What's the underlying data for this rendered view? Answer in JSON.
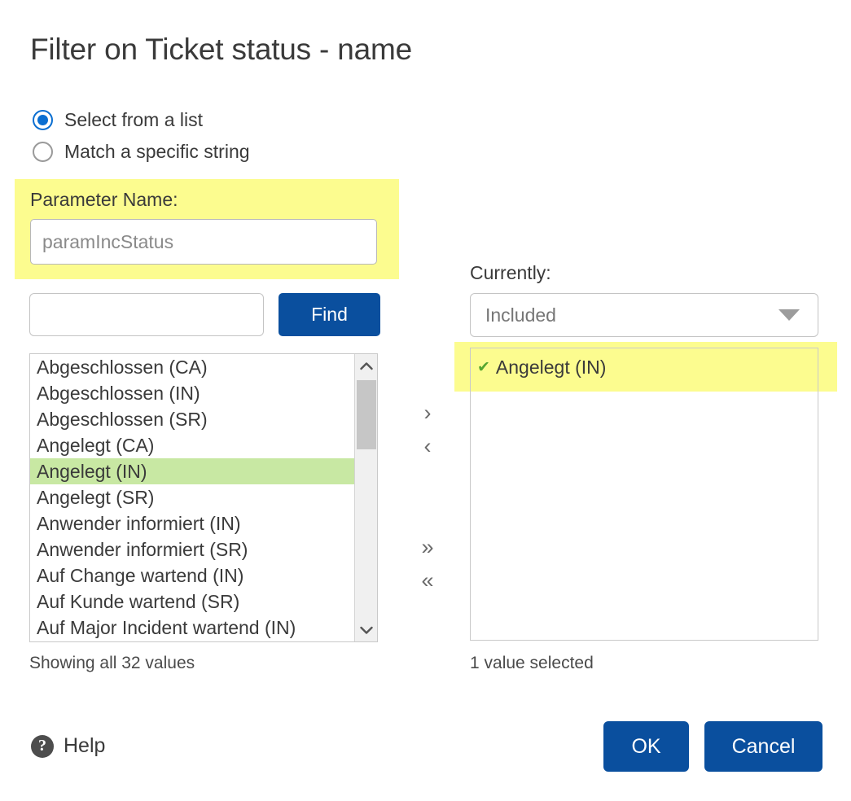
{
  "dialog": {
    "title": "Filter on Ticket status - name"
  },
  "mode": {
    "options": [
      {
        "label": "Select from a list",
        "selected": true
      },
      {
        "label": "Match a specific string",
        "selected": false
      }
    ]
  },
  "parameter": {
    "label": "Parameter Name:",
    "value": "paramIncStatus",
    "placeholder": "paramIncStatus",
    "highlight_color": "#fcfc8f"
  },
  "search": {
    "value": "",
    "placeholder": "",
    "find_label": "Find"
  },
  "available_list": {
    "items": [
      {
        "label": "Abgeschlossen (CA)",
        "selected": false
      },
      {
        "label": "Abgeschlossen (IN)",
        "selected": false
      },
      {
        "label": "Abgeschlossen (SR)",
        "selected": false
      },
      {
        "label": "Angelegt (CA)",
        "selected": false
      },
      {
        "label": "Angelegt (IN)",
        "selected": true
      },
      {
        "label": "Angelegt (SR)",
        "selected": false
      },
      {
        "label": "Anwender informiert (IN)",
        "selected": false
      },
      {
        "label": "Anwender informiert (SR)",
        "selected": false
      },
      {
        "label": "Auf Change wartend (IN)",
        "selected": false
      },
      {
        "label": "Auf Kunde wartend (SR)",
        "selected": false
      },
      {
        "label": "Auf Major Incident wartend (IN)",
        "selected": false
      }
    ],
    "selection_color": "#c8e8a3",
    "status": "Showing all 32 values"
  },
  "transfer": {
    "add": "›",
    "remove": "‹",
    "add_all": "»",
    "remove_all": "«"
  },
  "currently": {
    "label": "Currently:",
    "mode_value": "Included",
    "selected_items": [
      {
        "label": "Angelegt (IN)",
        "check": "✔"
      }
    ],
    "highlight_color": "#fcfc8f",
    "check_color": "#55a630",
    "status": "1 value selected"
  },
  "footer": {
    "help_label": "Help",
    "help_glyph": "?",
    "ok_label": "OK",
    "cancel_label": "Cancel",
    "accent_color": "#0a4f9e"
  },
  "scrollbar": {
    "up_glyph": "⌃",
    "down_glyph": "⌄"
  }
}
